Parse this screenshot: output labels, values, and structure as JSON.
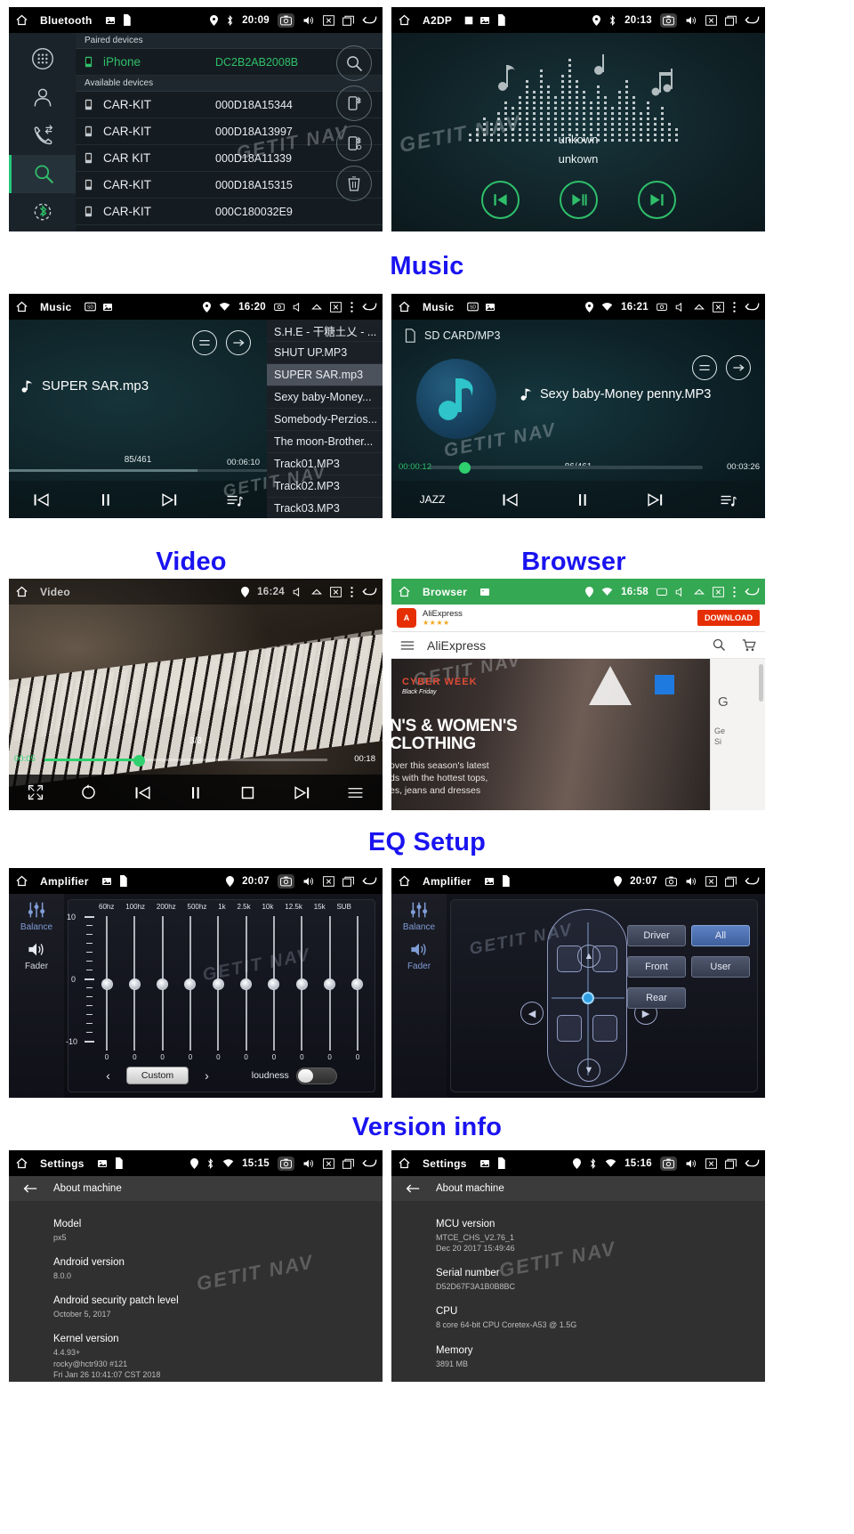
{
  "sections": {
    "music": "Music",
    "video": "Video",
    "browser": "Browser",
    "eq": "EQ Setup",
    "version": "Version info"
  },
  "watermark": "GETIT NAV",
  "colors": {
    "accent_green": "#2fbf6a",
    "heading_blue": "#1a13f0",
    "browser_green": "#35a853",
    "ali_red": "#e62e04"
  },
  "bluetooth": {
    "statusbar": {
      "title": "Bluetooth",
      "time": "20:09"
    },
    "paired_header": "Paired devices",
    "available_header": "Available devices",
    "paired": [
      {
        "name": "iPhone",
        "mac": "DC2B2AB2008B"
      }
    ],
    "available": [
      {
        "name": "CAR-KIT",
        "mac": "000D18A15344"
      },
      {
        "name": "CAR-KIT",
        "mac": "000D18A13997"
      },
      {
        "name": "CAR KIT",
        "mac": "000D18A11339"
      },
      {
        "name": "CAR-KIT",
        "mac": "000D18A15315"
      },
      {
        "name": "CAR-KIT",
        "mac": "000C180032E9"
      }
    ],
    "sidebar": [
      "dialpad-icon",
      "contacts-icon",
      "call-log-icon",
      "search-icon",
      "bluetooth-settings-icon"
    ],
    "actions": [
      "search-icon",
      "pair-device-icon",
      "connect-device-icon",
      "delete-icon"
    ]
  },
  "a2dp": {
    "statusbar": {
      "title": "A2DP",
      "time": "20:13"
    },
    "track": "unkown",
    "artist": "unkown",
    "controls": [
      "previous-icon",
      "play-pause-icon",
      "next-icon"
    ]
  },
  "music_left": {
    "statusbar": {
      "title": "Music",
      "time": "16:20"
    },
    "now_playing": "SUPER SAR.mp3",
    "counter": "85/461",
    "duration": "00:06:10",
    "playlist": [
      "S.H.E - 干糖土乂 - ...",
      "SHUT UP.MP3",
      "SUPER SAR.mp3",
      "Sexy baby-Money...",
      "Somebody-Perzios...",
      "The moon-Brother...",
      "Track01.MP3",
      "Track02.MP3",
      "Track03.MP3"
    ],
    "selected_index": 2,
    "mode_buttons": [
      "equalizer-icon",
      "repeat-mode-icon"
    ],
    "controls": [
      "previous-icon",
      "pause-icon",
      "next-icon",
      "playlist-icon"
    ]
  },
  "music_right": {
    "statusbar": {
      "title": "Music",
      "time": "16:21"
    },
    "source_path": "SD CARD/MP3",
    "now_playing": "Sexy baby-Money penny.MP3",
    "counter": "86/461",
    "current_time": "00:00:12",
    "total_time": "00:03:26",
    "eq_preset": "JAZZ",
    "controls": [
      "previous-icon",
      "pause-icon",
      "next-icon",
      "playlist-icon"
    ]
  },
  "video": {
    "statusbar": {
      "title": "Video",
      "time": "16:24"
    },
    "counter": "3/3",
    "current_time": "00:05",
    "total_time": "00:18",
    "controls": [
      "fullscreen-icon",
      "repeat-icon",
      "previous-icon",
      "pause-icon",
      "stop-icon",
      "next-icon",
      "playlist-icon"
    ]
  },
  "browser": {
    "statusbar": {
      "title": "Browser",
      "time": "16:58"
    },
    "ad": {
      "name": "AliExpress",
      "stars": "★★★★",
      "download_label": "DOWNLOAD"
    },
    "brand": "AliExpress",
    "hero": {
      "badge": "CYBER WEEK",
      "badge_sub": "Black Friday",
      "headline_1": "N'S & WOMEN'S",
      "headline_2": "CLOTHING",
      "sub_1": "over this season's latest",
      "sub_2": "ds with the hottest tops,",
      "sub_3": "es, jeans and dresses"
    },
    "side_text_1": "Ge",
    "side_text_2": "Si",
    "toolbar_icons": [
      "menu-icon",
      "search-icon",
      "cart-icon"
    ]
  },
  "eq": {
    "statusbar": {
      "title": "Amplifier",
      "time": "20:07"
    },
    "sidebar": {
      "balance_label": "Balance",
      "fader_label": "Fader"
    },
    "frequencies": [
      "60hz",
      "100hz",
      "200hz",
      "500hz",
      "1k",
      "2.5k",
      "10k",
      "12.5k",
      "15k",
      "SUB"
    ],
    "values": [
      0,
      0,
      0,
      0,
      0,
      0,
      0,
      0,
      0,
      0
    ],
    "axis_top": "10",
    "axis_mid": "0",
    "axis_bottom": "-10",
    "preset": "Custom",
    "prev_label": "‹",
    "next_label": "›",
    "loudness_label": "loudness",
    "loudness_on": false
  },
  "fader": {
    "statusbar": {
      "title": "Amplifier",
      "time": "20:07"
    },
    "sidebar": {
      "balance_label": "Balance",
      "fader_label": "Fader"
    },
    "buttons_left": [
      "Driver",
      "Front",
      "Rear"
    ],
    "buttons_right": [
      "All",
      "User"
    ],
    "selected": "All"
  },
  "settings_left": {
    "statusbar": {
      "title": "Settings",
      "time": "15:15"
    },
    "subtitle": "About machine",
    "items": [
      {
        "key": "Model",
        "value": "px5"
      },
      {
        "key": "Android version",
        "value": "8.0.0"
      },
      {
        "key": "Android security patch level",
        "value": "October 5, 2017"
      },
      {
        "key": "Kernel version",
        "value": "4.4.93+\nrocky@hctr930 #121\nFri Jan 26 10:41:07 CST 2018"
      }
    ]
  },
  "settings_right": {
    "statusbar": {
      "title": "Settings",
      "time": "15:16"
    },
    "subtitle": "About machine",
    "items": [
      {
        "key": "MCU version",
        "value": "MTCE_CHS_V2.76_1\nDec 20 2017 15:49:46"
      },
      {
        "key": "Serial number",
        "value": "D52D67F3A1B0B8BC"
      },
      {
        "key": "CPU",
        "value": "8 core 64-bit CPU Coretex-A53 @ 1.5G"
      },
      {
        "key": "Memory",
        "value": "3891 MB"
      }
    ]
  }
}
